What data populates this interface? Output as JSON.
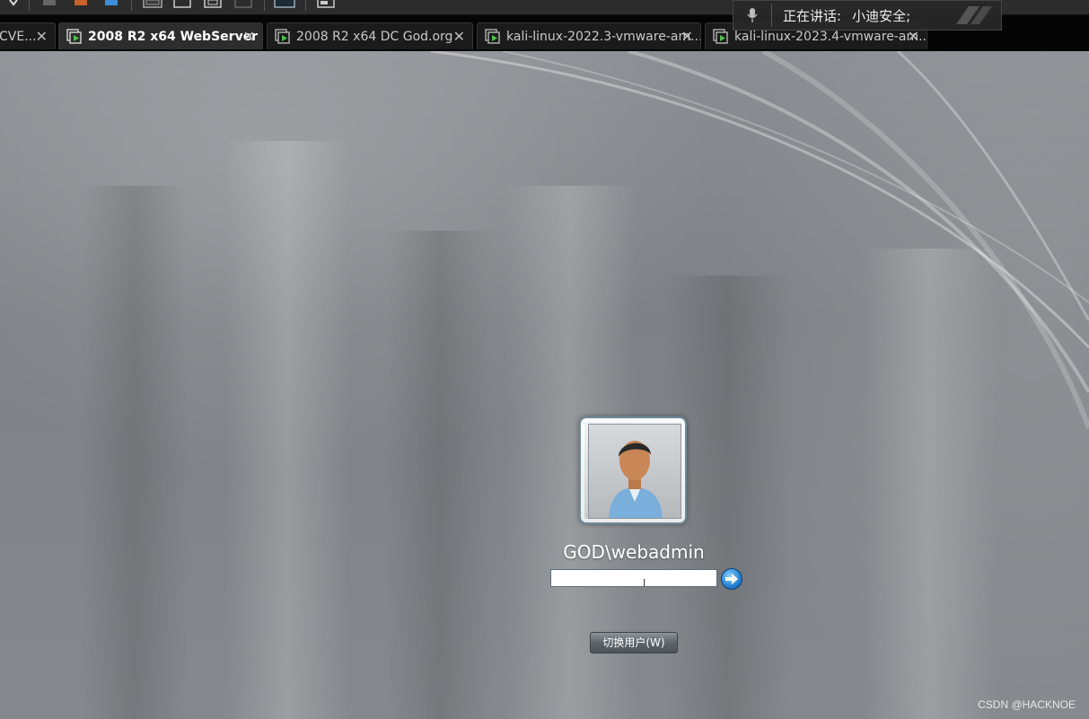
{
  "tabs": [
    {
      "label": "CVE...",
      "active": false
    },
    {
      "label": "2008 R2 x64 WebServer",
      "active": true
    },
    {
      "label": "2008 R2 x64 DC God.org",
      "active": false
    },
    {
      "label": "kali-linux-2022.3-vmware-am...",
      "active": false
    },
    {
      "label": "kali-linux-2023.4-vmware-am...",
      "active": false
    }
  ],
  "speaker": {
    "speaking_label": "正在讲话:",
    "speaker_name": "小迪安全;"
  },
  "login": {
    "username": "GOD\\webadmin",
    "password_value": "",
    "switch_user_label": "切换用户(W)"
  },
  "watermark": "CSDN @HACKNOE",
  "colors": {
    "desktop_bg": "#85898d",
    "tab_bg_active": "#2d2d2d",
    "tabstrip_bg": "#050505",
    "arrow_blue": "#2a88d8"
  },
  "icons": {
    "toolbar": [
      "dropdown-icon",
      "snapshot-icon",
      "revert-icon",
      "manage-snapshots-icon",
      "view-icon",
      "fullscreen-icon",
      "unity-icon",
      "stretch-icon",
      "console-icon"
    ],
    "tab": "vm-running-icon",
    "mic": "microphone-icon",
    "submit": "arrow-right-icon"
  }
}
